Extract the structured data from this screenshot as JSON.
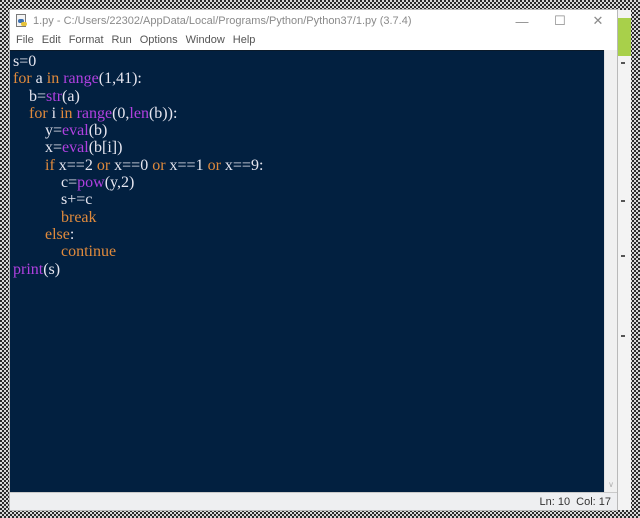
{
  "window": {
    "title": "1.py - C:/Users/22302/AppData/Local/Programs/Python/Python37/1.py (3.7.4)",
    "icon": "python-file-icon",
    "controls": {
      "minimize_glyph": "—",
      "maximize_glyph": "☐",
      "close_glyph": "✕"
    }
  },
  "menubar": {
    "items": [
      {
        "label": "File"
      },
      {
        "label": "Edit"
      },
      {
        "label": "Format"
      },
      {
        "label": "Run"
      },
      {
        "label": "Options"
      },
      {
        "label": "Window"
      },
      {
        "label": "Help"
      }
    ]
  },
  "editor": {
    "colors": {
      "background": "#022040",
      "text": "#e6e6f0",
      "keyword": "#e08a3c",
      "builtin": "#b040e0"
    },
    "lines": [
      [
        {
          "t": "s=0",
          "c": "n"
        }
      ],
      [
        {
          "t": "for",
          "c": "kw"
        },
        {
          "t": " a ",
          "c": "n"
        },
        {
          "t": "in",
          "c": "kw"
        },
        {
          "t": " ",
          "c": "n"
        },
        {
          "t": "range",
          "c": "bi"
        },
        {
          "t": "(1,41):",
          "c": "n"
        }
      ],
      [
        {
          "t": "    b=",
          "c": "n"
        },
        {
          "t": "str",
          "c": "bi"
        },
        {
          "t": "(a)",
          "c": "n"
        }
      ],
      [
        {
          "t": "    ",
          "c": "n"
        },
        {
          "t": "for",
          "c": "kw"
        },
        {
          "t": " i ",
          "c": "n"
        },
        {
          "t": "in",
          "c": "kw"
        },
        {
          "t": " ",
          "c": "n"
        },
        {
          "t": "range",
          "c": "bi"
        },
        {
          "t": "(0,",
          "c": "n"
        },
        {
          "t": "len",
          "c": "bi"
        },
        {
          "t": "(b)):",
          "c": "n"
        }
      ],
      [
        {
          "t": "        y=",
          "c": "n"
        },
        {
          "t": "eval",
          "c": "bi"
        },
        {
          "t": "(b)",
          "c": "n"
        }
      ],
      [
        {
          "t": "        x=",
          "c": "n"
        },
        {
          "t": "eval",
          "c": "bi"
        },
        {
          "t": "(b[i])",
          "c": "n"
        }
      ],
      [
        {
          "t": "        ",
          "c": "n"
        },
        {
          "t": "if",
          "c": "kw"
        },
        {
          "t": " x==2 ",
          "c": "n"
        },
        {
          "t": "or",
          "c": "kw"
        },
        {
          "t": " x==0 ",
          "c": "n"
        },
        {
          "t": "or",
          "c": "kw"
        },
        {
          "t": " x==1 ",
          "c": "n"
        },
        {
          "t": "or",
          "c": "kw"
        },
        {
          "t": " x==9:",
          "c": "n"
        }
      ],
      [
        {
          "t": "            c=",
          "c": "n"
        },
        {
          "t": "pow",
          "c": "bi"
        },
        {
          "t": "(y,2)",
          "c": "n"
        }
      ],
      [
        {
          "t": "            s+=c",
          "c": "n"
        }
      ],
      [
        {
          "t": "            ",
          "c": "n"
        },
        {
          "t": "break",
          "c": "kw"
        }
      ],
      [
        {
          "t": "        ",
          "c": "n"
        },
        {
          "t": "else",
          "c": "kw"
        },
        {
          "t": ":",
          "c": "n"
        }
      ],
      [
        {
          "t": "            ",
          "c": "n"
        },
        {
          "t": "continue",
          "c": "kw"
        }
      ],
      [
        {
          "t": "print",
          "c": "bi"
        },
        {
          "t": "(s)",
          "c": "n"
        }
      ]
    ]
  },
  "statusbar": {
    "line": "Ln: 10",
    "col": "Col: 17"
  }
}
